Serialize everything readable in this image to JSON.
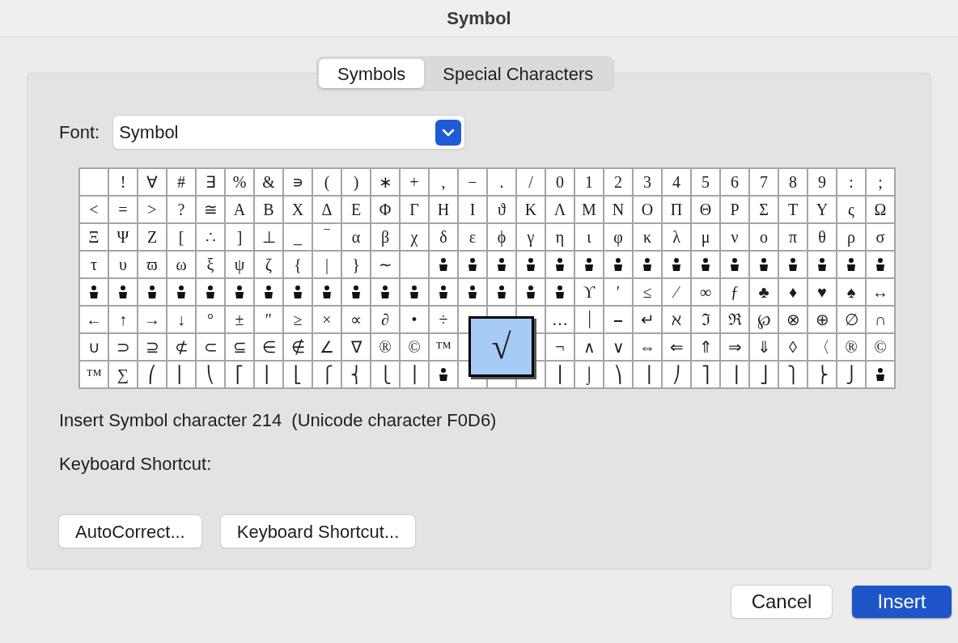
{
  "window": {
    "title": "Symbol"
  },
  "tabs": [
    {
      "label": "Symbols",
      "selected": true
    },
    {
      "label": "Special Characters",
      "selected": false
    }
  ],
  "font": {
    "label": "Font:",
    "value": "Symbol"
  },
  "grid": [
    [
      {
        "kind": "blank",
        "selected": false
      },
      {
        "kind": "char",
        "text": "!",
        "selected": false
      },
      {
        "kind": "char",
        "text": "∀",
        "selected": false
      },
      {
        "kind": "char",
        "text": "#",
        "selected": false
      },
      {
        "kind": "char",
        "text": "∃",
        "selected": false
      },
      {
        "kind": "char",
        "text": "%",
        "selected": false
      },
      {
        "kind": "char",
        "text": "&",
        "selected": false
      },
      {
        "kind": "char",
        "text": "∍",
        "selected": false
      },
      {
        "kind": "char",
        "text": "(",
        "selected": false
      },
      {
        "kind": "char",
        "text": ")",
        "selected": false
      },
      {
        "kind": "char",
        "text": "∗",
        "selected": false
      },
      {
        "kind": "char",
        "text": "+",
        "selected": false
      },
      {
        "kind": "char",
        "text": ",",
        "selected": false
      },
      {
        "kind": "char",
        "text": "−",
        "selected": false
      },
      {
        "kind": "char",
        "text": ".",
        "selected": false
      },
      {
        "kind": "char",
        "text": "/",
        "selected": false
      },
      {
        "kind": "char",
        "text": "0",
        "selected": false
      },
      {
        "kind": "char",
        "text": "1",
        "selected": false
      },
      {
        "kind": "char",
        "text": "2",
        "selected": false
      },
      {
        "kind": "char",
        "text": "3",
        "selected": false
      },
      {
        "kind": "char",
        "text": "4",
        "selected": false
      },
      {
        "kind": "char",
        "text": "5",
        "selected": false
      },
      {
        "kind": "char",
        "text": "6",
        "selected": false
      },
      {
        "kind": "char",
        "text": "7",
        "selected": false
      },
      {
        "kind": "char",
        "text": "8",
        "selected": false
      },
      {
        "kind": "char",
        "text": "9",
        "selected": false
      },
      {
        "kind": "char",
        "text": ":",
        "selected": false
      },
      {
        "kind": "char",
        "text": ";",
        "selected": false
      }
    ],
    [
      {
        "kind": "char",
        "text": "<",
        "selected": false
      },
      {
        "kind": "char",
        "text": "=",
        "selected": false
      },
      {
        "kind": "char",
        "text": ">",
        "selected": false
      },
      {
        "kind": "char",
        "text": "?",
        "selected": false
      },
      {
        "kind": "char",
        "text": "≅",
        "selected": false
      },
      {
        "kind": "char",
        "text": "Α",
        "selected": false
      },
      {
        "kind": "char",
        "text": "Β",
        "selected": false
      },
      {
        "kind": "char",
        "text": "Χ",
        "selected": false
      },
      {
        "kind": "char",
        "text": "Δ",
        "selected": false
      },
      {
        "kind": "char",
        "text": "Ε",
        "selected": false
      },
      {
        "kind": "char",
        "text": "Φ",
        "selected": false
      },
      {
        "kind": "char",
        "text": "Γ",
        "selected": false
      },
      {
        "kind": "char",
        "text": "Η",
        "selected": false
      },
      {
        "kind": "char",
        "text": "Ι",
        "selected": false
      },
      {
        "kind": "char",
        "text": "ϑ",
        "selected": false
      },
      {
        "kind": "char",
        "text": "Κ",
        "selected": false
      },
      {
        "kind": "char",
        "text": "Λ",
        "selected": false
      },
      {
        "kind": "char",
        "text": "Μ",
        "selected": false
      },
      {
        "kind": "char",
        "text": "Ν",
        "selected": false
      },
      {
        "kind": "char",
        "text": "Ο",
        "selected": false
      },
      {
        "kind": "char",
        "text": "Π",
        "selected": false
      },
      {
        "kind": "char",
        "text": "Θ",
        "selected": false
      },
      {
        "kind": "char",
        "text": "Ρ",
        "selected": false
      },
      {
        "kind": "char",
        "text": "Σ",
        "selected": false
      },
      {
        "kind": "char",
        "text": "Τ",
        "selected": false
      },
      {
        "kind": "char",
        "text": "Υ",
        "selected": false
      },
      {
        "kind": "char",
        "text": "ς",
        "selected": false
      },
      {
        "kind": "char",
        "text": "Ω",
        "selected": false
      }
    ],
    [
      {
        "kind": "char",
        "text": "Ξ",
        "selected": false
      },
      {
        "kind": "char",
        "text": "Ψ",
        "selected": false
      },
      {
        "kind": "char",
        "text": "Ζ",
        "selected": false
      },
      {
        "kind": "char",
        "text": "[",
        "selected": false
      },
      {
        "kind": "char",
        "text": "∴",
        "selected": false
      },
      {
        "kind": "char",
        "text": "]",
        "selected": false
      },
      {
        "kind": "char",
        "text": "⊥",
        "selected": false
      },
      {
        "kind": "char",
        "text": "_",
        "selected": false
      },
      {
        "kind": "char",
        "text": "‾",
        "selected": false
      },
      {
        "kind": "char",
        "text": "α",
        "selected": false
      },
      {
        "kind": "char",
        "text": "β",
        "selected": false
      },
      {
        "kind": "char",
        "text": "χ",
        "selected": false
      },
      {
        "kind": "char",
        "text": "δ",
        "selected": false
      },
      {
        "kind": "char",
        "text": "ε",
        "selected": false
      },
      {
        "kind": "char",
        "text": "ϕ",
        "selected": false
      },
      {
        "kind": "char",
        "text": "γ",
        "selected": false
      },
      {
        "kind": "char",
        "text": "η",
        "selected": false
      },
      {
        "kind": "char",
        "text": "ι",
        "selected": false
      },
      {
        "kind": "char",
        "text": "φ",
        "selected": false
      },
      {
        "kind": "char",
        "text": "κ",
        "selected": false
      },
      {
        "kind": "char",
        "text": "λ",
        "selected": false
      },
      {
        "kind": "char",
        "text": "μ",
        "selected": false
      },
      {
        "kind": "char",
        "text": "ν",
        "selected": false
      },
      {
        "kind": "char",
        "text": "ο",
        "selected": false
      },
      {
        "kind": "char",
        "text": "π",
        "selected": false
      },
      {
        "kind": "char",
        "text": "θ",
        "selected": false
      },
      {
        "kind": "char",
        "text": "ρ",
        "selected": false
      },
      {
        "kind": "char",
        "text": "σ",
        "selected": false
      }
    ],
    [
      {
        "kind": "char",
        "text": "τ",
        "selected": false
      },
      {
        "kind": "char",
        "text": "υ",
        "selected": false
      },
      {
        "kind": "char",
        "text": "ϖ",
        "selected": false
      },
      {
        "kind": "char",
        "text": "ω",
        "selected": false
      },
      {
        "kind": "char",
        "text": "ξ",
        "selected": false
      },
      {
        "kind": "char",
        "text": "ψ",
        "selected": false
      },
      {
        "kind": "char",
        "text": "ζ",
        "selected": false
      },
      {
        "kind": "char",
        "text": "{",
        "selected": false
      },
      {
        "kind": "char",
        "text": "|",
        "selected": false
      },
      {
        "kind": "char",
        "text": "}",
        "selected": false
      },
      {
        "kind": "char",
        "text": "∼",
        "selected": false
      },
      {
        "kind": "blank",
        "selected": false
      },
      {
        "kind": "icon",
        "selected": false
      },
      {
        "kind": "icon",
        "selected": false
      },
      {
        "kind": "icon",
        "selected": false
      },
      {
        "kind": "icon",
        "selected": false
      },
      {
        "kind": "icon",
        "selected": false
      },
      {
        "kind": "icon",
        "selected": false
      },
      {
        "kind": "icon",
        "selected": false
      },
      {
        "kind": "icon",
        "selected": false
      },
      {
        "kind": "icon",
        "selected": false
      },
      {
        "kind": "icon",
        "selected": false
      },
      {
        "kind": "icon",
        "selected": false
      },
      {
        "kind": "icon",
        "selected": false
      },
      {
        "kind": "icon",
        "selected": false
      },
      {
        "kind": "icon",
        "selected": false
      },
      {
        "kind": "icon",
        "selected": false
      },
      {
        "kind": "icon",
        "selected": false
      }
    ],
    [
      {
        "kind": "icon",
        "selected": false
      },
      {
        "kind": "icon",
        "selected": false
      },
      {
        "kind": "icon",
        "selected": false
      },
      {
        "kind": "icon",
        "selected": false
      },
      {
        "kind": "icon",
        "selected": false
      },
      {
        "kind": "icon",
        "selected": false
      },
      {
        "kind": "icon",
        "selected": false
      },
      {
        "kind": "icon",
        "selected": false
      },
      {
        "kind": "icon",
        "selected": false
      },
      {
        "kind": "icon",
        "selected": false
      },
      {
        "kind": "icon",
        "selected": false
      },
      {
        "kind": "icon",
        "selected": false
      },
      {
        "kind": "icon",
        "selected": false
      },
      {
        "kind": "icon",
        "selected": false
      },
      {
        "kind": "icon",
        "selected": false
      },
      {
        "kind": "icon",
        "selected": false
      },
      {
        "kind": "icon",
        "selected": false
      },
      {
        "kind": "char",
        "text": "ϒ",
        "selected": false
      },
      {
        "kind": "char",
        "text": "′",
        "selected": false
      },
      {
        "kind": "char",
        "text": "≤",
        "selected": false
      },
      {
        "kind": "char",
        "text": "⁄",
        "selected": false
      },
      {
        "kind": "char",
        "text": "∞",
        "selected": false
      },
      {
        "kind": "char",
        "text": "ƒ",
        "selected": false
      },
      {
        "kind": "char",
        "text": "♣",
        "selected": false
      },
      {
        "kind": "char",
        "text": "♦",
        "selected": false
      },
      {
        "kind": "char",
        "text": "♥",
        "selected": false
      },
      {
        "kind": "char",
        "text": "♠",
        "selected": false
      },
      {
        "kind": "char",
        "text": "↔",
        "selected": false
      }
    ],
    [
      {
        "kind": "char",
        "text": "←",
        "selected": false
      },
      {
        "kind": "char",
        "text": "↑",
        "selected": false
      },
      {
        "kind": "char",
        "text": "→",
        "selected": false
      },
      {
        "kind": "char",
        "text": "↓",
        "selected": false
      },
      {
        "kind": "char",
        "text": "°",
        "selected": false
      },
      {
        "kind": "char",
        "text": "±",
        "selected": false
      },
      {
        "kind": "char",
        "text": "″",
        "selected": false
      },
      {
        "kind": "char",
        "text": "≥",
        "selected": false
      },
      {
        "kind": "char",
        "text": "×",
        "selected": false
      },
      {
        "kind": "char",
        "text": "∝",
        "selected": false
      },
      {
        "kind": "char",
        "text": "∂",
        "selected": false
      },
      {
        "kind": "char",
        "text": "•",
        "selected": false
      },
      {
        "kind": "char",
        "text": "÷",
        "selected": false
      },
      {
        "kind": "blank",
        "selected": false
      },
      {
        "kind": "blank",
        "selected": false
      },
      {
        "kind": "blank",
        "selected": false
      },
      {
        "kind": "char",
        "text": "…",
        "selected": false
      },
      {
        "kind": "char",
        "text": "⏐",
        "selected": false
      },
      {
        "kind": "char",
        "text": "⎯",
        "selected": false
      },
      {
        "kind": "char",
        "text": "↵",
        "selected": false
      },
      {
        "kind": "char",
        "text": "ℵ",
        "selected": false
      },
      {
        "kind": "char",
        "text": "ℑ",
        "selected": false
      },
      {
        "kind": "char",
        "text": "ℜ",
        "selected": false
      },
      {
        "kind": "char",
        "text": "℘",
        "selected": false
      },
      {
        "kind": "char",
        "text": "⊗",
        "selected": false
      },
      {
        "kind": "char",
        "text": "⊕",
        "selected": false
      },
      {
        "kind": "char",
        "text": "∅",
        "selected": false
      },
      {
        "kind": "char",
        "text": "∩",
        "selected": false
      }
    ],
    [
      {
        "kind": "char",
        "text": "∪",
        "selected": false
      },
      {
        "kind": "char",
        "text": "⊃",
        "selected": false
      },
      {
        "kind": "char",
        "text": "⊇",
        "selected": false
      },
      {
        "kind": "char",
        "text": "⊄",
        "selected": false
      },
      {
        "kind": "char",
        "text": "⊂",
        "selected": false
      },
      {
        "kind": "char",
        "text": "⊆",
        "selected": false
      },
      {
        "kind": "char",
        "text": "∈",
        "selected": false
      },
      {
        "kind": "char",
        "text": "∉",
        "selected": false
      },
      {
        "kind": "char",
        "text": "∠",
        "selected": false
      },
      {
        "kind": "char",
        "text": "∇",
        "selected": false
      },
      {
        "kind": "char",
        "text": "®",
        "selected": false
      },
      {
        "kind": "char",
        "text": "©",
        "selected": false
      },
      {
        "kind": "char",
        "text": "™",
        "selected": false
      },
      {
        "kind": "blank",
        "selected": false
      },
      {
        "kind": "char",
        "text": "√",
        "selected": true
      },
      {
        "kind": "blank",
        "selected": false
      },
      {
        "kind": "char",
        "text": "¬",
        "selected": false
      },
      {
        "kind": "char",
        "text": "∧",
        "selected": false
      },
      {
        "kind": "char",
        "text": "∨",
        "selected": false
      },
      {
        "kind": "char",
        "text": "⇔",
        "selected": false
      },
      {
        "kind": "char",
        "text": "⇐",
        "selected": false
      },
      {
        "kind": "char",
        "text": "⇑",
        "selected": false
      },
      {
        "kind": "char",
        "text": "⇒",
        "selected": false
      },
      {
        "kind": "char",
        "text": "⇓",
        "selected": false
      },
      {
        "kind": "char",
        "text": "◊",
        "selected": false
      },
      {
        "kind": "char",
        "text": "〈",
        "selected": false
      },
      {
        "kind": "char",
        "text": "®",
        "selected": false
      },
      {
        "kind": "char",
        "text": "©",
        "selected": false
      }
    ],
    [
      {
        "kind": "char",
        "text": "™",
        "selected": false
      },
      {
        "kind": "char",
        "text": "∑",
        "selected": false
      },
      {
        "kind": "char",
        "text": "⎛",
        "selected": false
      },
      {
        "kind": "char",
        "text": "⎜",
        "selected": false
      },
      {
        "kind": "char",
        "text": "⎝",
        "selected": false
      },
      {
        "kind": "char",
        "text": "⎡",
        "selected": false
      },
      {
        "kind": "char",
        "text": "⎢",
        "selected": false
      },
      {
        "kind": "char",
        "text": "⎣",
        "selected": false
      },
      {
        "kind": "char",
        "text": "⎧",
        "selected": false
      },
      {
        "kind": "char",
        "text": "⎨",
        "selected": false
      },
      {
        "kind": "char",
        "text": "⎩",
        "selected": false
      },
      {
        "kind": "char",
        "text": "⎪",
        "selected": false
      },
      {
        "kind": "icon",
        "selected": false
      },
      {
        "kind": "blank",
        "selected": false
      },
      {
        "kind": "blank",
        "selected": false
      },
      {
        "kind": "blank",
        "selected": false
      },
      {
        "kind": "char",
        "text": "⎮",
        "selected": false
      },
      {
        "kind": "char",
        "text": "⌡",
        "selected": false
      },
      {
        "kind": "char",
        "text": "⎞",
        "selected": false
      },
      {
        "kind": "char",
        "text": "⎟",
        "selected": false
      },
      {
        "kind": "char",
        "text": "⎠",
        "selected": false
      },
      {
        "kind": "char",
        "text": "⎤",
        "selected": false
      },
      {
        "kind": "char",
        "text": "⎥",
        "selected": false
      },
      {
        "kind": "char",
        "text": "⎦",
        "selected": false
      },
      {
        "kind": "char",
        "text": "⎫",
        "selected": false
      },
      {
        "kind": "char",
        "text": "⎬",
        "selected": false
      },
      {
        "kind": "char",
        "text": "⎭",
        "selected": false
      },
      {
        "kind": "icon",
        "selected": false
      }
    ]
  ],
  "info": "Insert Symbol character 214  (Unicode character F0D6)",
  "shortcut_label": "Keyboard Shortcut:",
  "panel_buttons": [
    "AutoCorrect...",
    "Keyboard Shortcut..."
  ],
  "footer_buttons": [
    {
      "label": "Cancel",
      "kind": "secondary"
    },
    {
      "label": "Insert",
      "kind": "primary"
    }
  ]
}
